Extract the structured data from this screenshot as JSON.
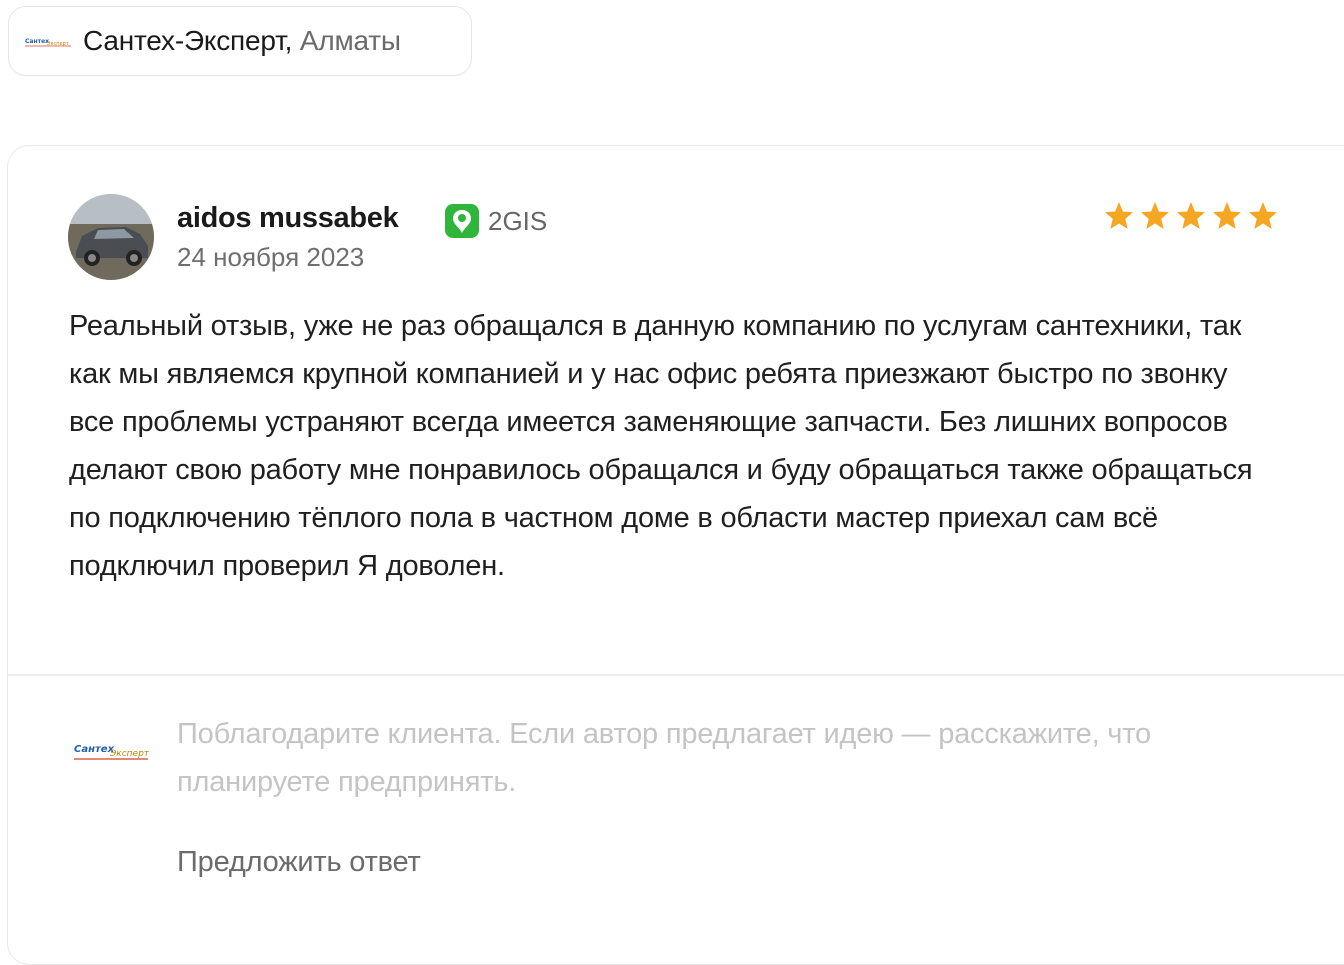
{
  "company": {
    "name": "Сантех-Эксперт",
    "separator": ",",
    "city": " Алматы",
    "logo_text": "СантехЭксперт",
    "logo_icon": "company-logo"
  },
  "review": {
    "author": "aidos mussabek",
    "source": "2GIS",
    "source_icon": "2gis-icon",
    "date": "24 ноября 2023",
    "rating": 5,
    "rating_max": 5,
    "star_color": "#f5a623",
    "text": "Реальный отзыв, уже не раз обращался в данную компанию по услугам сантехники, так как мы являемся крупной компанией и у нас офис ребята приезжают быстро по звонку все проблемы устраняют всегда имеется заменяющие запчасти. Без лишних вопросов делают свою работу мне понравилось обращался и буду обращаться также обращаться по подключению тёплого пола в частном доме в области мастер приехал сам всё подключил проверил Я доволен."
  },
  "reply": {
    "placeholder": "Поблагодарите клиента. Если автор предлагает идею — расскажите, что планируете предпринять.",
    "suggest_label": "Предложить ответ"
  }
}
